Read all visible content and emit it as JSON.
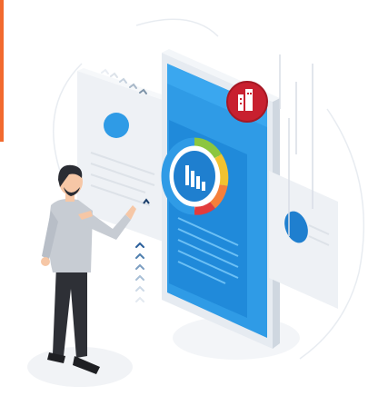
{
  "colors": {
    "accent_bar": "#f26a2e",
    "phone_blue": "#2f9be6",
    "phone_blue_dark": "#1f7fcf",
    "phone_body": "#e9eef4",
    "badge_red": "#c8202f",
    "chart_green": "#8cc63f",
    "chart_yellow": "#f2c230",
    "chart_orange": "#f57f3a",
    "chart_red": "#e23c3c",
    "panel_gray": "#edf0f4",
    "shirt_gray": "#c7ccd3",
    "pants_dark": "#2e3036",
    "skin": "#f6c7a6",
    "hair_dark": "#2a2c33"
  },
  "icons": {
    "badge": "building-chart-icon",
    "chart_center": "bar-chart-icon",
    "chevrons": "chevron-up-icon"
  },
  "scene": {
    "description_name": "isometric-mobile-analytics-illustration"
  }
}
